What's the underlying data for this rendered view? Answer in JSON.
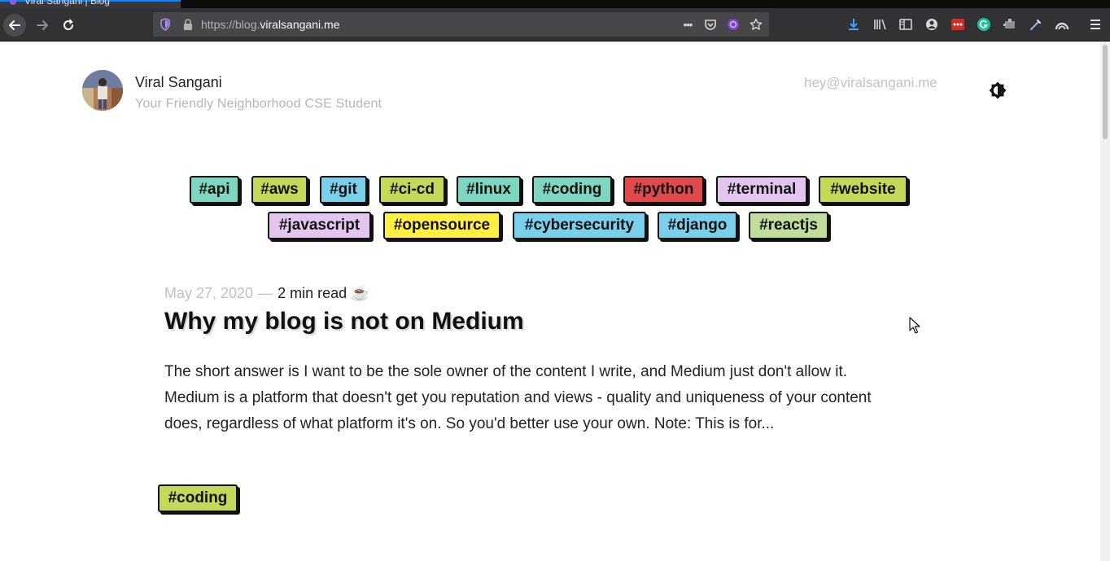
{
  "browser": {
    "tab_title": "Viral Sangani | Blog",
    "url_prefix": "https://blog.",
    "url_host": "viralsangani.me",
    "more_label": "•••"
  },
  "author": {
    "name": "Viral Sangani",
    "tagline": "Your Friendly Neighborhood CSE Student",
    "email": "hey@viralsangani.me"
  },
  "tags": [
    {
      "label": "#api",
      "color": "#7fd6c0"
    },
    {
      "label": "#aws",
      "color": "#c4d85a"
    },
    {
      "label": "#git",
      "color": "#7ad0ea"
    },
    {
      "label": "#ci-cd",
      "color": "#c4d85a"
    },
    {
      "label": "#linux",
      "color": "#7fd6c0"
    },
    {
      "label": "#coding",
      "color": "#7fd6c0"
    },
    {
      "label": "#python",
      "color": "#e04a4a"
    },
    {
      "label": "#terminal",
      "color": "#e3c6ef"
    },
    {
      "label": "#website",
      "color": "#c4d85a"
    },
    {
      "label": "#javascript",
      "color": "#e3c6ef"
    },
    {
      "label": "#opensource",
      "color": "#ffee44"
    },
    {
      "label": "#cybersecurity",
      "color": "#7ad0ea"
    },
    {
      "label": "#django",
      "color": "#7ad0ea"
    },
    {
      "label": "#reactjs",
      "color": "#c0dd9e"
    }
  ],
  "post": {
    "date": "May 27, 2020",
    "separator": "—",
    "read_time": "2 min read ☕",
    "title": "Why my blog is not on Medium",
    "excerpt": "The short answer is I want to be the sole owner of the content I write, and Medium just don't allow it. Medium is a platform that doesn't get you reputation and views - quality and uniqueness of your content does, regardless of what platform it's on. So you'd better use your own. Note: This is for...",
    "tag": {
      "label": "#coding",
      "color": "#c4d85a"
    }
  }
}
